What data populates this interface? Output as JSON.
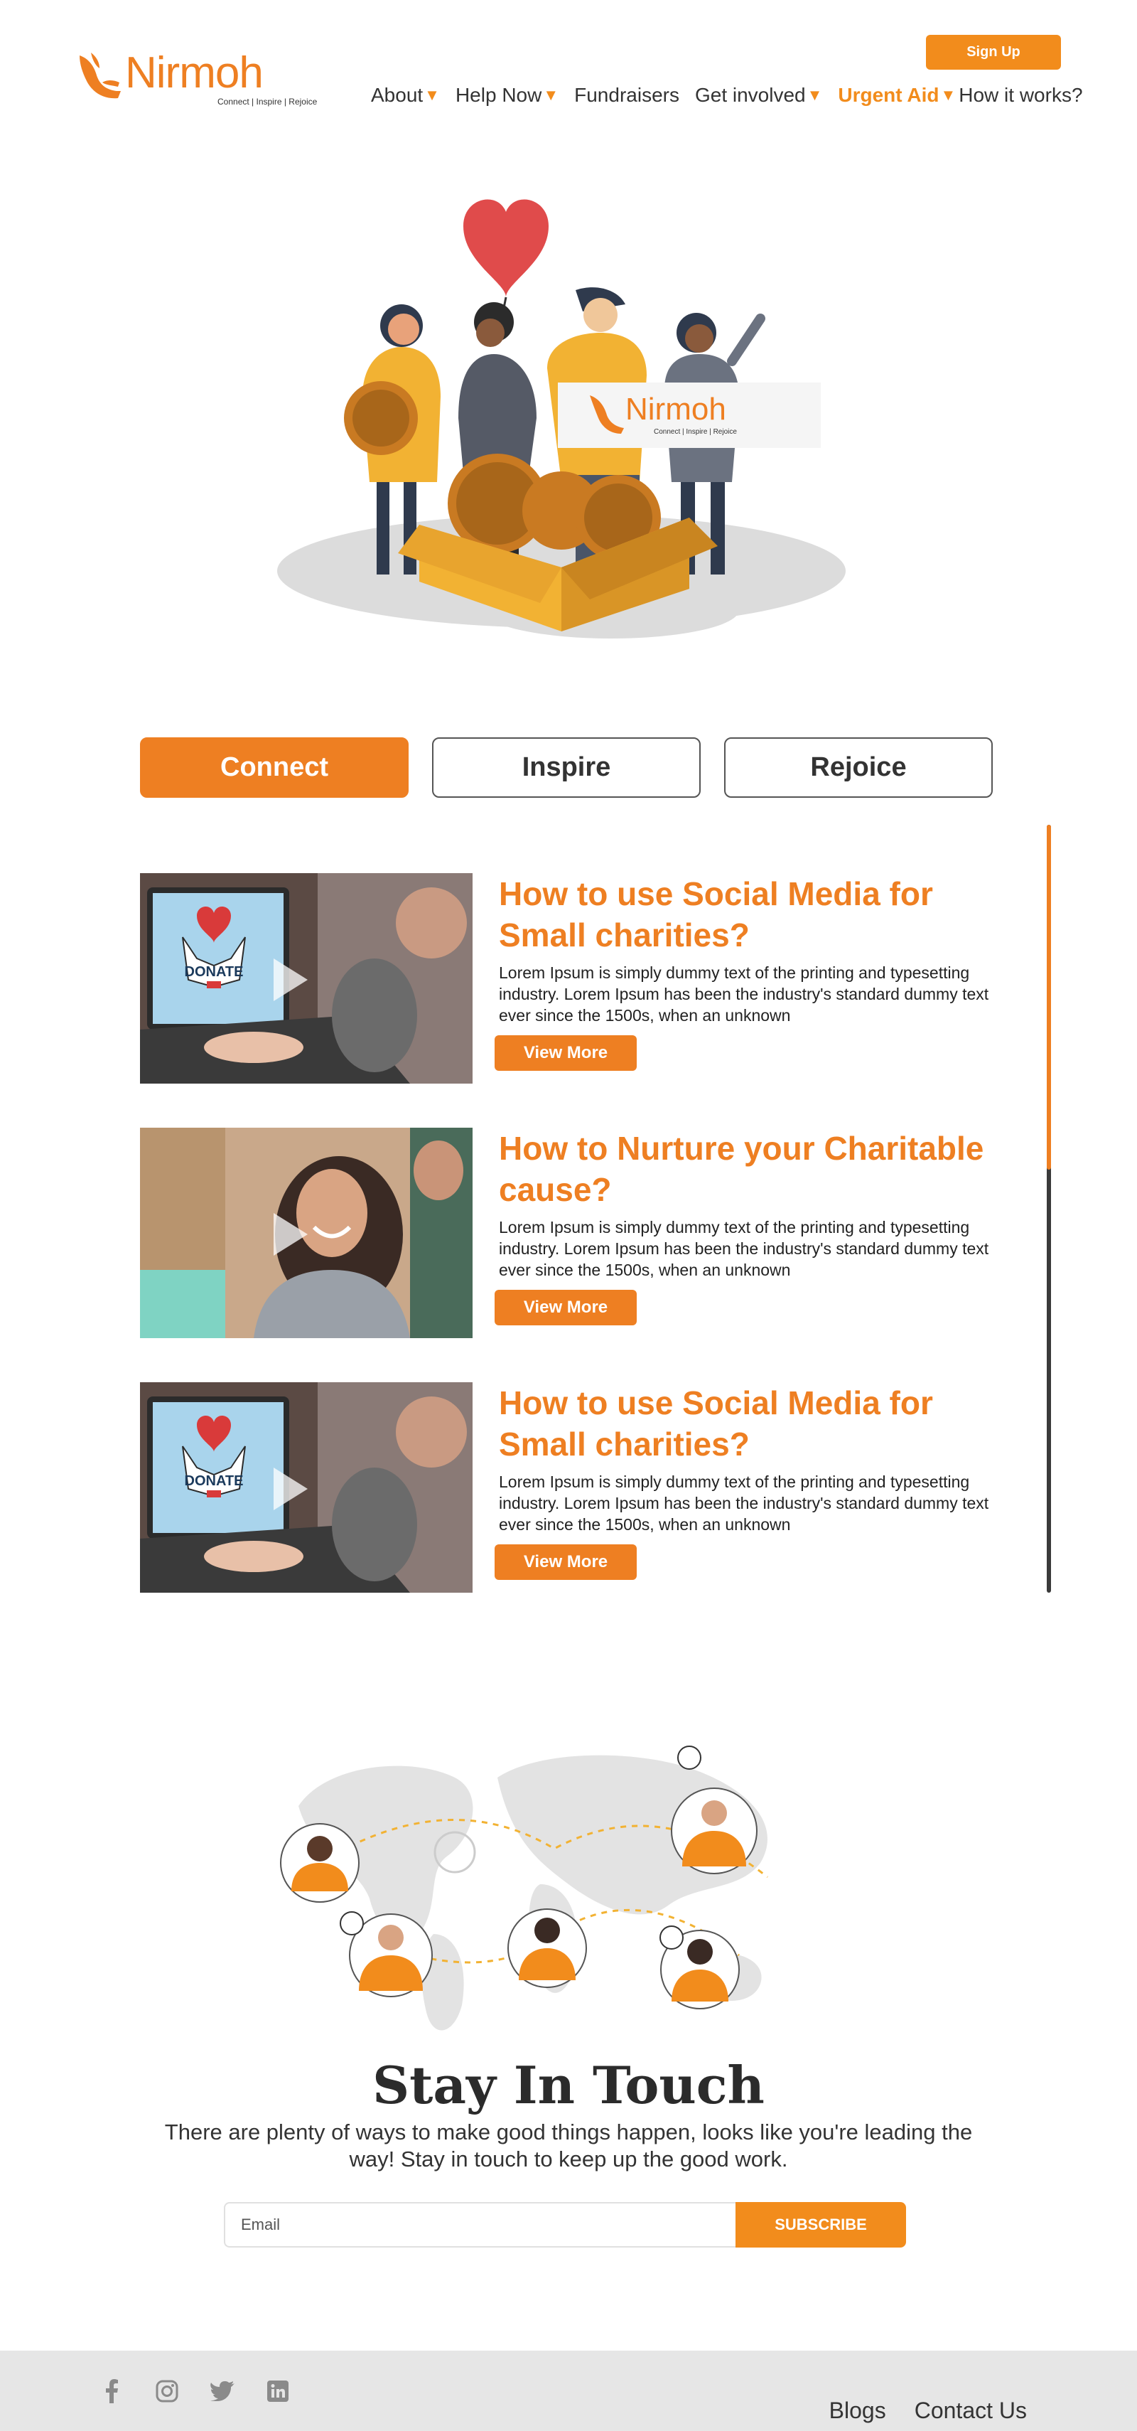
{
  "brand": {
    "name": "Nirmoh",
    "tagline": "Connect | Inspire | Rejoice"
  },
  "header": {
    "signup_label": "Sign Up",
    "nav": [
      {
        "label": "About",
        "dropdown": true
      },
      {
        "label": "Help Now",
        "dropdown": true
      },
      {
        "label": "Fundraisers",
        "dropdown": false
      },
      {
        "label": "Get involved",
        "dropdown": true
      },
      {
        "label": "Urgent Aid",
        "dropdown": true,
        "highlight": true
      },
      {
        "label": "How it works?",
        "dropdown": false
      }
    ]
  },
  "hero": {
    "sign_text": "Nirmoh",
    "sign_tagline": "Connect | Inspire | Rejoice"
  },
  "tabs": [
    {
      "label": "Connect",
      "active": true
    },
    {
      "label": "Inspire",
      "active": false
    },
    {
      "label": "Rejoice",
      "active": false
    }
  ],
  "articles": [
    {
      "title": "How to use Social Media for Small charities?",
      "description": "Lorem Ipsum is simply dummy text of the printing and typesetting industry. Lorem Ipsum has been the industry's standard dummy text ever since the 1500s, when an unknown",
      "button": "View More",
      "image": "donate-laptop",
      "image_text": "DONATE"
    },
    {
      "title": "How to Nurture your Charitable cause?",
      "description": "Lorem Ipsum is simply dummy text of the printing and typesetting industry. Lorem Ipsum has been the industry's standard dummy text ever since the 1500s, when an unknown",
      "button": "View More",
      "image": "smiling-woman",
      "image_text": ""
    },
    {
      "title": "How to use Social Media for Small charities?",
      "description": "Lorem Ipsum is simply dummy text of the printing and typesetting industry. Lorem Ipsum has been the industry's standard dummy text ever since the 1500s, when an unknown",
      "button": "View More",
      "image": "donate-laptop",
      "image_text": "DONATE"
    }
  ],
  "stay_in_touch": {
    "title": "Stay In Touch",
    "text": "There are plenty of ways to make good things happen, looks like you're leading the way! Stay in touch to keep up the good work.",
    "email_placeholder": "Email",
    "subscribe_label": "SUBSCRIBE"
  },
  "footer": {
    "socials": [
      "facebook-icon",
      "instagram-icon",
      "twitter-icon",
      "linkedin-icon"
    ],
    "links": [
      "Blogs",
      "Contact Us"
    ]
  },
  "colors": {
    "accent": "#ee7f22",
    "footer_bg": "#e6e6e6",
    "text": "#2b2b2b"
  }
}
